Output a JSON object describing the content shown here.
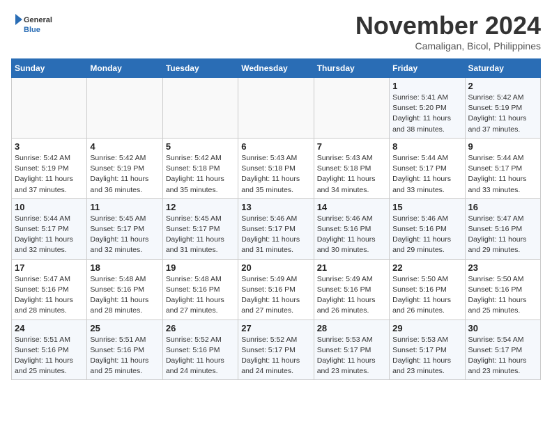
{
  "header": {
    "logo_general": "General",
    "logo_blue": "Blue",
    "month_title": "November 2024",
    "location": "Camaligan, Bicol, Philippines"
  },
  "weekdays": [
    "Sunday",
    "Monday",
    "Tuesday",
    "Wednesday",
    "Thursday",
    "Friday",
    "Saturday"
  ],
  "weeks": [
    [
      {
        "day": "",
        "info": ""
      },
      {
        "day": "",
        "info": ""
      },
      {
        "day": "",
        "info": ""
      },
      {
        "day": "",
        "info": ""
      },
      {
        "day": "",
        "info": ""
      },
      {
        "day": "1",
        "info": "Sunrise: 5:41 AM\nSunset: 5:20 PM\nDaylight: 11 hours and 38 minutes."
      },
      {
        "day": "2",
        "info": "Sunrise: 5:42 AM\nSunset: 5:19 PM\nDaylight: 11 hours and 37 minutes."
      }
    ],
    [
      {
        "day": "3",
        "info": "Sunrise: 5:42 AM\nSunset: 5:19 PM\nDaylight: 11 hours and 37 minutes."
      },
      {
        "day": "4",
        "info": "Sunrise: 5:42 AM\nSunset: 5:19 PM\nDaylight: 11 hours and 36 minutes."
      },
      {
        "day": "5",
        "info": "Sunrise: 5:42 AM\nSunset: 5:18 PM\nDaylight: 11 hours and 35 minutes."
      },
      {
        "day": "6",
        "info": "Sunrise: 5:43 AM\nSunset: 5:18 PM\nDaylight: 11 hours and 35 minutes."
      },
      {
        "day": "7",
        "info": "Sunrise: 5:43 AM\nSunset: 5:18 PM\nDaylight: 11 hours and 34 minutes."
      },
      {
        "day": "8",
        "info": "Sunrise: 5:44 AM\nSunset: 5:17 PM\nDaylight: 11 hours and 33 minutes."
      },
      {
        "day": "9",
        "info": "Sunrise: 5:44 AM\nSunset: 5:17 PM\nDaylight: 11 hours and 33 minutes."
      }
    ],
    [
      {
        "day": "10",
        "info": "Sunrise: 5:44 AM\nSunset: 5:17 PM\nDaylight: 11 hours and 32 minutes."
      },
      {
        "day": "11",
        "info": "Sunrise: 5:45 AM\nSunset: 5:17 PM\nDaylight: 11 hours and 32 minutes."
      },
      {
        "day": "12",
        "info": "Sunrise: 5:45 AM\nSunset: 5:17 PM\nDaylight: 11 hours and 31 minutes."
      },
      {
        "day": "13",
        "info": "Sunrise: 5:46 AM\nSunset: 5:17 PM\nDaylight: 11 hours and 31 minutes."
      },
      {
        "day": "14",
        "info": "Sunrise: 5:46 AM\nSunset: 5:16 PM\nDaylight: 11 hours and 30 minutes."
      },
      {
        "day": "15",
        "info": "Sunrise: 5:46 AM\nSunset: 5:16 PM\nDaylight: 11 hours and 29 minutes."
      },
      {
        "day": "16",
        "info": "Sunrise: 5:47 AM\nSunset: 5:16 PM\nDaylight: 11 hours and 29 minutes."
      }
    ],
    [
      {
        "day": "17",
        "info": "Sunrise: 5:47 AM\nSunset: 5:16 PM\nDaylight: 11 hours and 28 minutes."
      },
      {
        "day": "18",
        "info": "Sunrise: 5:48 AM\nSunset: 5:16 PM\nDaylight: 11 hours and 28 minutes."
      },
      {
        "day": "19",
        "info": "Sunrise: 5:48 AM\nSunset: 5:16 PM\nDaylight: 11 hours and 27 minutes."
      },
      {
        "day": "20",
        "info": "Sunrise: 5:49 AM\nSunset: 5:16 PM\nDaylight: 11 hours and 27 minutes."
      },
      {
        "day": "21",
        "info": "Sunrise: 5:49 AM\nSunset: 5:16 PM\nDaylight: 11 hours and 26 minutes."
      },
      {
        "day": "22",
        "info": "Sunrise: 5:50 AM\nSunset: 5:16 PM\nDaylight: 11 hours and 26 minutes."
      },
      {
        "day": "23",
        "info": "Sunrise: 5:50 AM\nSunset: 5:16 PM\nDaylight: 11 hours and 25 minutes."
      }
    ],
    [
      {
        "day": "24",
        "info": "Sunrise: 5:51 AM\nSunset: 5:16 PM\nDaylight: 11 hours and 25 minutes."
      },
      {
        "day": "25",
        "info": "Sunrise: 5:51 AM\nSunset: 5:16 PM\nDaylight: 11 hours and 25 minutes."
      },
      {
        "day": "26",
        "info": "Sunrise: 5:52 AM\nSunset: 5:16 PM\nDaylight: 11 hours and 24 minutes."
      },
      {
        "day": "27",
        "info": "Sunrise: 5:52 AM\nSunset: 5:17 PM\nDaylight: 11 hours and 24 minutes."
      },
      {
        "day": "28",
        "info": "Sunrise: 5:53 AM\nSunset: 5:17 PM\nDaylight: 11 hours and 23 minutes."
      },
      {
        "day": "29",
        "info": "Sunrise: 5:53 AM\nSunset: 5:17 PM\nDaylight: 11 hours and 23 minutes."
      },
      {
        "day": "30",
        "info": "Sunrise: 5:54 AM\nSunset: 5:17 PM\nDaylight: 11 hours and 23 minutes."
      }
    ]
  ]
}
